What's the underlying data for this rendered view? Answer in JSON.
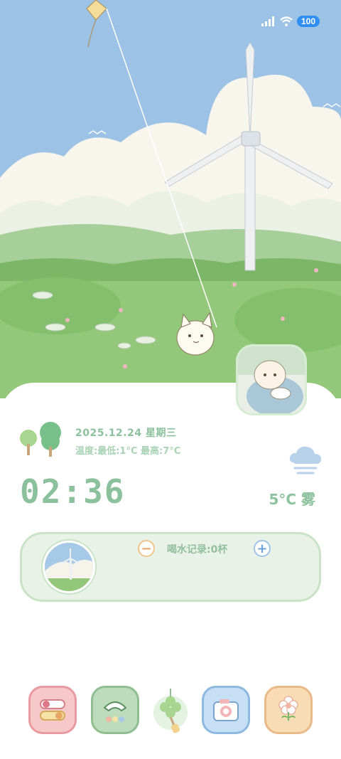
{
  "status_bar": {
    "battery": "100"
  },
  "info": {
    "date": "2025.12.24 星期三",
    "temperature_range": "温度:最低:1°C 最高:7°C",
    "time": "02:36",
    "weather": "5°C 雾"
  },
  "water": {
    "label": "喝水记录:0杯"
  },
  "dock": [
    {
      "name": "settings",
      "icon": "toggle-icon",
      "color": "#f6c8c8"
    },
    {
      "name": "phone",
      "icon": "phone-icon",
      "color": "#bcdcbc"
    },
    {
      "name": "clover",
      "icon": "clover-charm-icon",
      "color": "#c7e5c3"
    },
    {
      "name": "camera",
      "icon": "camera-icon",
      "color": "#c6dff5"
    },
    {
      "name": "flower",
      "icon": "flower-icon",
      "color": "#f8dcb5"
    }
  ],
  "colors": {
    "accent_green": "#8cc19d",
    "sky": "#9cc2e5",
    "card_bg": "#e8f2e7"
  }
}
